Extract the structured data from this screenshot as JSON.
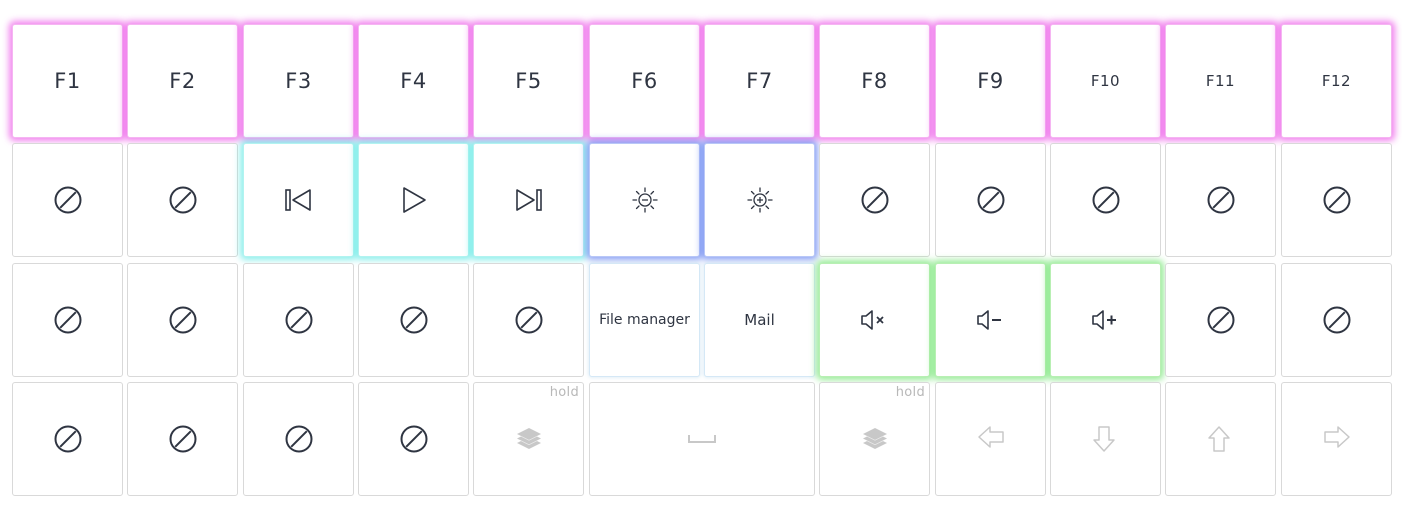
{
  "colors": {
    "key_border": "#d9d9d9",
    "glyph_dark": "#2f3542",
    "glyph_light": "#c8c8c8",
    "glow_pink": "#ec5ae8",
    "glow_cyan": "#5ce8e4",
    "glow_blue": "#6684f0",
    "glow_green": "#6ee46e"
  },
  "rows": [
    {
      "keys": [
        {
          "id": "f1",
          "label": "F1",
          "glow": "pink"
        },
        {
          "id": "f2",
          "label": "F2",
          "glow": "pink"
        },
        {
          "id": "f3",
          "label": "F3",
          "glow": "pink"
        },
        {
          "id": "f4",
          "label": "F4",
          "glow": "pink"
        },
        {
          "id": "f5",
          "label": "F5",
          "glow": "pink"
        },
        {
          "id": "f6",
          "label": "F6",
          "glow": "pink"
        },
        {
          "id": "f7",
          "label": "F7",
          "glow": "pink"
        },
        {
          "id": "f8",
          "label": "F8",
          "glow": "pink"
        },
        {
          "id": "f9",
          "label": "F9",
          "glow": "pink"
        },
        {
          "id": "f10",
          "label": "F10",
          "glow": "pink"
        },
        {
          "id": "f11",
          "label": "F11",
          "glow": "pink"
        },
        {
          "id": "f12",
          "label": "F12",
          "glow": "pink"
        }
      ]
    },
    {
      "keys": [
        {
          "id": "r2k1",
          "icon": "no-action-icon"
        },
        {
          "id": "r2k2",
          "icon": "no-action-icon"
        },
        {
          "id": "media-previous",
          "icon": "previous-track-icon",
          "glow": "cyan"
        },
        {
          "id": "media-play",
          "icon": "play-icon",
          "glow": "cyan"
        },
        {
          "id": "media-next",
          "icon": "next-track-icon",
          "glow": "cyan"
        },
        {
          "id": "brightness-down",
          "icon": "brightness-down-icon",
          "glow": "blue"
        },
        {
          "id": "brightness-up",
          "icon": "brightness-up-icon",
          "glow": "blue"
        },
        {
          "id": "r2k8",
          "icon": "no-action-icon"
        },
        {
          "id": "r2k9",
          "icon": "no-action-icon"
        },
        {
          "id": "r2k10",
          "icon": "no-action-icon"
        },
        {
          "id": "r2k11",
          "icon": "no-action-icon"
        },
        {
          "id": "r2k12",
          "icon": "no-action-icon"
        }
      ]
    },
    {
      "keys": [
        {
          "id": "r3k1",
          "icon": "no-action-icon"
        },
        {
          "id": "r3k2",
          "icon": "no-action-icon"
        },
        {
          "id": "r3k3",
          "icon": "no-action-icon"
        },
        {
          "id": "r3k4",
          "icon": "no-action-icon"
        },
        {
          "id": "r3k5",
          "icon": "no-action-icon"
        },
        {
          "id": "file-manager",
          "text": "File manager",
          "glow": "pale"
        },
        {
          "id": "mail",
          "text": "Mail",
          "glow": "pale"
        },
        {
          "id": "volume-mute",
          "icon": "volume-mute-icon",
          "glow": "green"
        },
        {
          "id": "volume-down",
          "icon": "volume-down-icon",
          "glow": "green"
        },
        {
          "id": "volume-up",
          "icon": "volume-up-icon",
          "glow": "green"
        },
        {
          "id": "r3k11",
          "icon": "no-action-icon"
        },
        {
          "id": "r3k12",
          "icon": "no-action-icon"
        }
      ]
    },
    {
      "keys": [
        {
          "id": "r4k1",
          "icon": "no-action-icon"
        },
        {
          "id": "r4k2",
          "icon": "no-action-icon"
        },
        {
          "id": "r4k3",
          "icon": "no-action-icon"
        },
        {
          "id": "r4k4",
          "icon": "no-action-icon"
        },
        {
          "id": "layer-left",
          "icon": "layers-icon",
          "hold": "hold"
        },
        {
          "id": "space",
          "icon": "space-bar-icon",
          "wide": 2
        },
        {
          "id": "layer-right",
          "icon": "layers-icon",
          "hold": "hold"
        },
        {
          "id": "arrow-left",
          "icon": "arrow-left-icon"
        },
        {
          "id": "arrow-down",
          "icon": "arrow-down-icon"
        },
        {
          "id": "arrow-up",
          "icon": "arrow-up-icon"
        },
        {
          "id": "arrow-right",
          "icon": "arrow-right-icon"
        }
      ]
    }
  ]
}
